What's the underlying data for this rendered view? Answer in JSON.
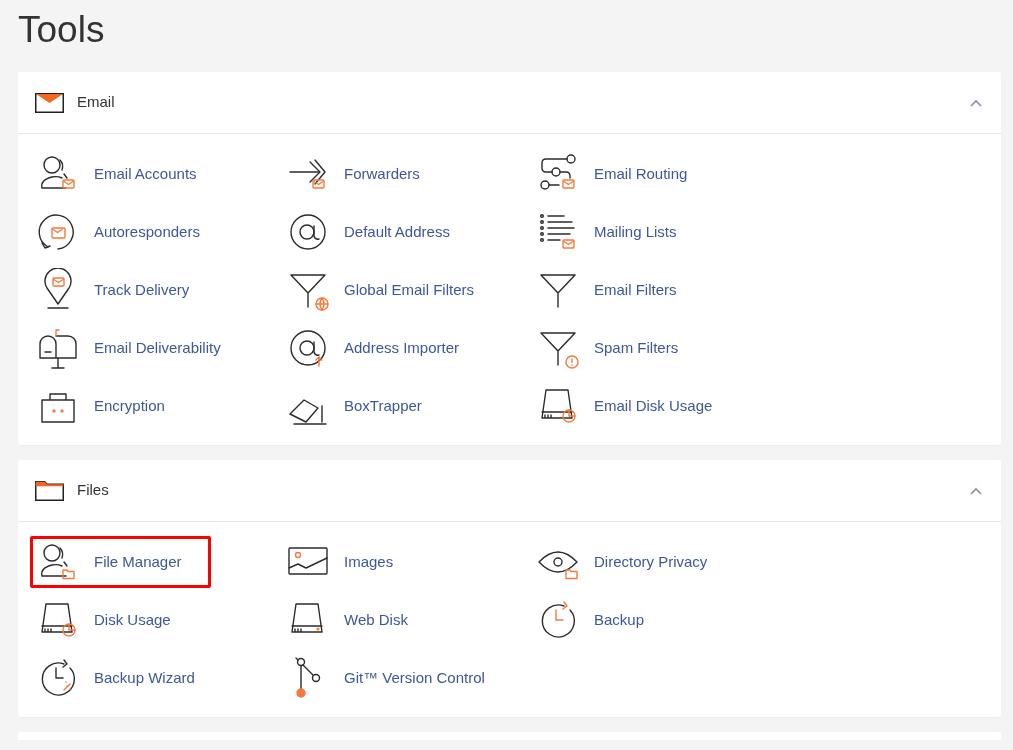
{
  "page_title": "Tools",
  "sections": [
    {
      "title": "Email",
      "expanded": true,
      "items": [
        {
          "label": "Email Accounts",
          "highlighted": false
        },
        {
          "label": "Forwarders",
          "highlighted": false
        },
        {
          "label": "Email Routing",
          "highlighted": false
        },
        {
          "label": "Autoresponders",
          "highlighted": false
        },
        {
          "label": "Default Address",
          "highlighted": false
        },
        {
          "label": "Mailing Lists",
          "highlighted": false
        },
        {
          "label": "Track Delivery",
          "highlighted": false
        },
        {
          "label": "Global Email Filters",
          "highlighted": false
        },
        {
          "label": "Email Filters",
          "highlighted": false
        },
        {
          "label": "Email Deliverability",
          "highlighted": false
        },
        {
          "label": "Address Importer",
          "highlighted": false
        },
        {
          "label": "Spam Filters",
          "highlighted": false
        },
        {
          "label": "Encryption",
          "highlighted": false
        },
        {
          "label": "BoxTrapper",
          "highlighted": false
        },
        {
          "label": "Email Disk Usage",
          "highlighted": false
        }
      ]
    },
    {
      "title": "Files",
      "expanded": true,
      "items": [
        {
          "label": "File Manager",
          "highlighted": true
        },
        {
          "label": "Images",
          "highlighted": false
        },
        {
          "label": "Directory Privacy",
          "highlighted": false
        },
        {
          "label": "Disk Usage",
          "highlighted": false
        },
        {
          "label": "Web Disk",
          "highlighted": false
        },
        {
          "label": "Backup",
          "highlighted": false
        },
        {
          "label": "Backup Wizard",
          "highlighted": false
        },
        {
          "label": "Git™ Version Control",
          "highlighted": false
        }
      ]
    }
  ]
}
